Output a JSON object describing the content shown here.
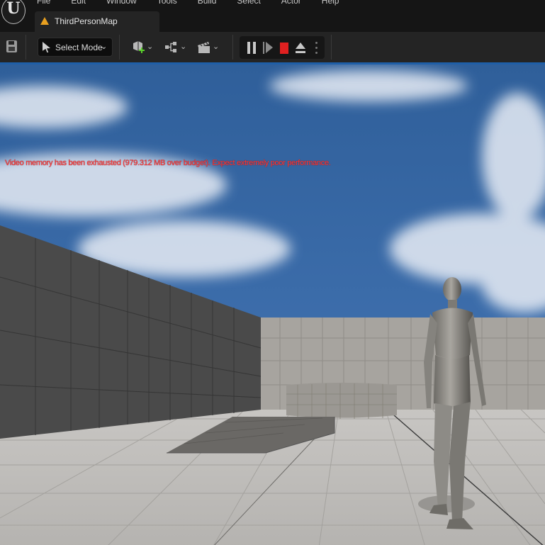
{
  "menu": [
    "File",
    "Edit",
    "Window",
    "Tools",
    "Build",
    "Select",
    "Actor",
    "Help"
  ],
  "logo_text": "U",
  "tab": {
    "title": "ThirdPersonMap",
    "icon": "warning-icon"
  },
  "toolbar": {
    "mode_label": "Select Mode",
    "save_icon": "save-icon",
    "add_icon": "add-actor-icon",
    "blueprint_icon": "blueprint-icon",
    "cinematics_icon": "clapperboard-icon"
  },
  "play_controls": [
    "pause-icon",
    "step-icon",
    "stop-icon",
    "eject-icon",
    "more-icon"
  ],
  "viewport": {
    "warning": "Video memory has been exhausted (979.312 MB over budget). Expect extremely poor performance.",
    "warning_color": "#ff3a3a"
  },
  "colors": {
    "accent": "#1f5fa8",
    "stop": "#e02020",
    "warning_tab": "#e8a020"
  }
}
